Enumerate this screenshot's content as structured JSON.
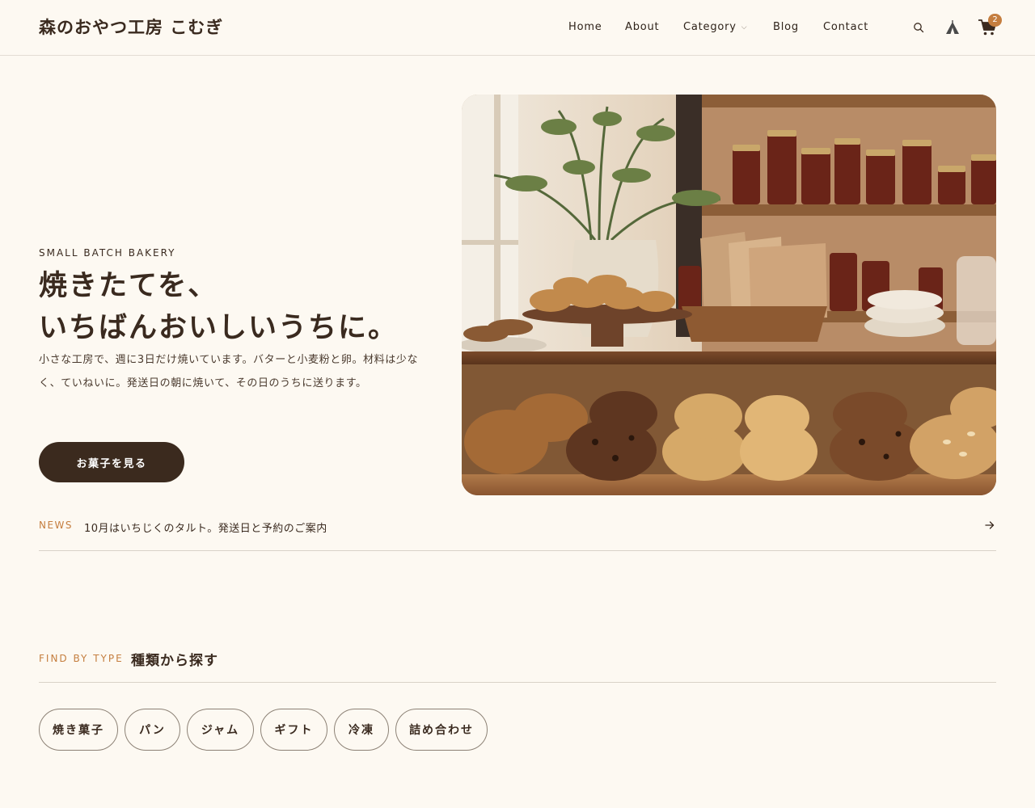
{
  "header": {
    "logo": "森のおやつ工房 こむぎ",
    "nav": [
      {
        "label": "Home"
      },
      {
        "label": "About"
      },
      {
        "label": "Category",
        "has_dropdown": true
      },
      {
        "label": "Blog"
      },
      {
        "label": "Contact"
      }
    ],
    "icons": [
      "search-icon",
      "tent-icon",
      "cart-icon"
    ],
    "cart_count": "2"
  },
  "hero": {
    "eyebrow": "SMALL BATCH BAKERY",
    "title_line1": "焼きたてを、",
    "title_line2": "いちばんおいしいうちに。",
    "description": "小さな工房で、週に3日だけ焼いています。バターと小麦粉と卵。材料は少なく、ていねいに。発送日の朝に焼いて、その日のうちに送ります。",
    "cta_label": "お菓子を見る",
    "image": "bakery-shelves-photo"
  },
  "news": {
    "label": "NEWS",
    "text": "10月はいちじくのタルト。発送日と予約のご案内"
  },
  "find_by_type": {
    "label": "FIND BY TYPE",
    "title": "種類から探す",
    "chips": [
      {
        "label": "焼き菓子"
      },
      {
        "label": "パン"
      },
      {
        "label": "ジャム"
      },
      {
        "label": "ギフト"
      },
      {
        "label": "冷凍"
      },
      {
        "label": "詰め合わせ"
      }
    ]
  },
  "colors": {
    "background": "#fdf9f2",
    "text": "#3a2a1f",
    "accent": "#c57e3f",
    "button": "#3b2a1e"
  }
}
